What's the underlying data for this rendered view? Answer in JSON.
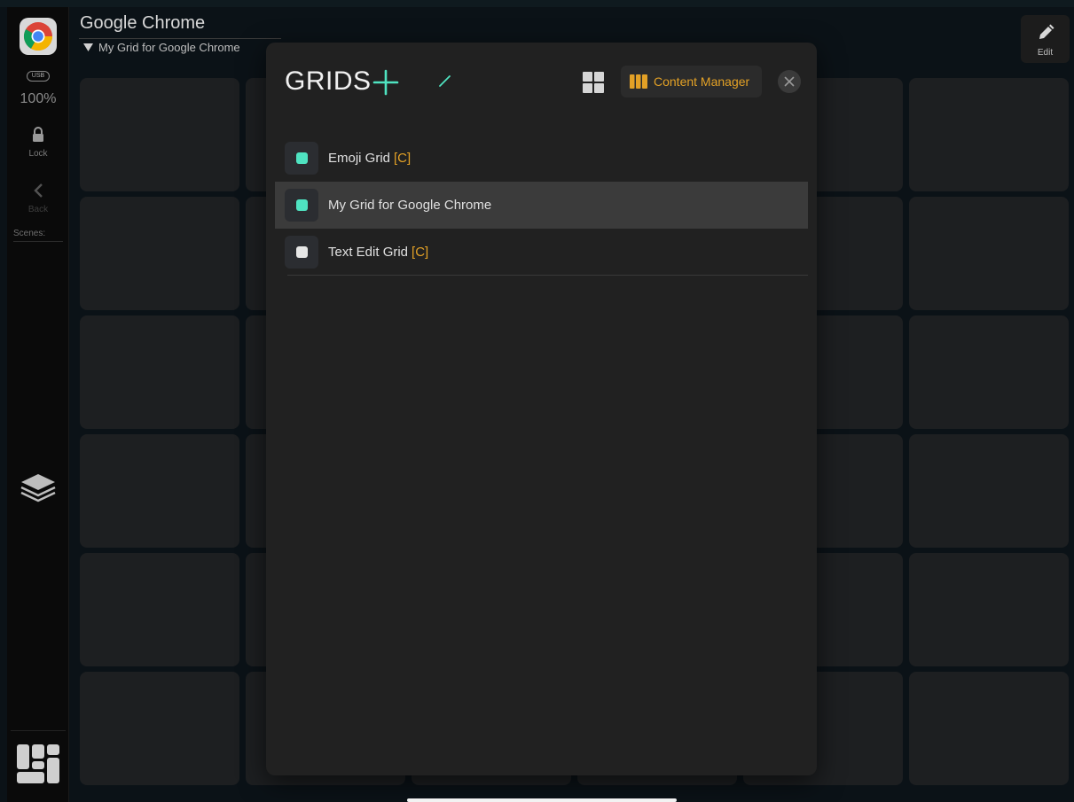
{
  "header": {
    "app_title": "Google Chrome",
    "current_grid": "My Grid for Google Chrome",
    "edit_label": "Edit"
  },
  "sidebar": {
    "usb_label": "USB",
    "zoom": "100%",
    "lock_label": "Lock",
    "back_label": "Back",
    "scenes_label": "Scenes:"
  },
  "modal": {
    "title": "GRIDS",
    "content_manager_label": "Content Manager",
    "grids": [
      {
        "name": "Emoji Grid",
        "tag": "[C]",
        "selected": false,
        "dot_color": "#4fe3c1"
      },
      {
        "name": "My Grid for Google Chrome",
        "tag": "",
        "selected": true,
        "dot_color": "#4fe3c1"
      },
      {
        "name": "Text Edit Grid",
        "tag": "[C]",
        "selected": false,
        "dot_color": "#e6e6e6"
      }
    ]
  },
  "colors": {
    "accent_teal": "#4fe3c1",
    "accent_orange": "#e3a126"
  },
  "icons": {
    "app": "chrome-icon",
    "lock": "lock-icon",
    "back": "chevron-left-icon",
    "layers": "layers-icon",
    "grid_layout": "grid-layout-icon",
    "edit": "pencil-icon",
    "add": "plus-icon",
    "rename": "pencil-icon",
    "layout": "grid-icon",
    "content_manager": "library-icon",
    "close": "close-icon"
  }
}
